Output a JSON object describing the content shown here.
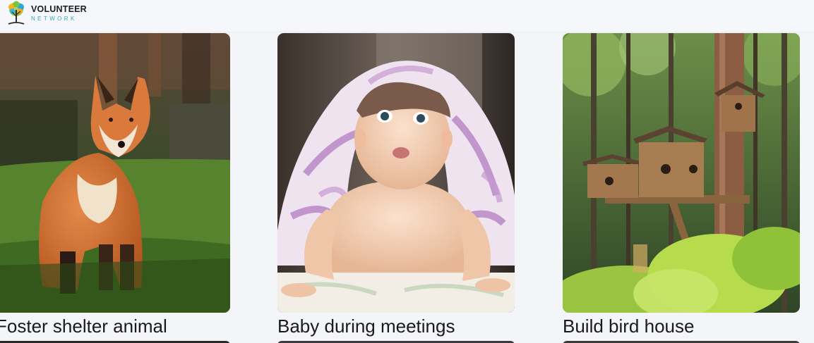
{
  "header": {
    "logo": {
      "line1": "VOLUNTEER",
      "line2": "NETWORK",
      "icon": "tree-logo-icon"
    }
  },
  "cards": [
    {
      "title": "Foster shelter animal",
      "image": "fox-photo"
    },
    {
      "title": "Baby during meetings",
      "image": "baby-photo"
    },
    {
      "title": "Build bird house",
      "image": "birdhouse-photo"
    }
  ],
  "colors": {
    "page_bg": "#f4f5f9",
    "brand_teal": "#2aa7c9",
    "text": "#1a1a1a"
  }
}
